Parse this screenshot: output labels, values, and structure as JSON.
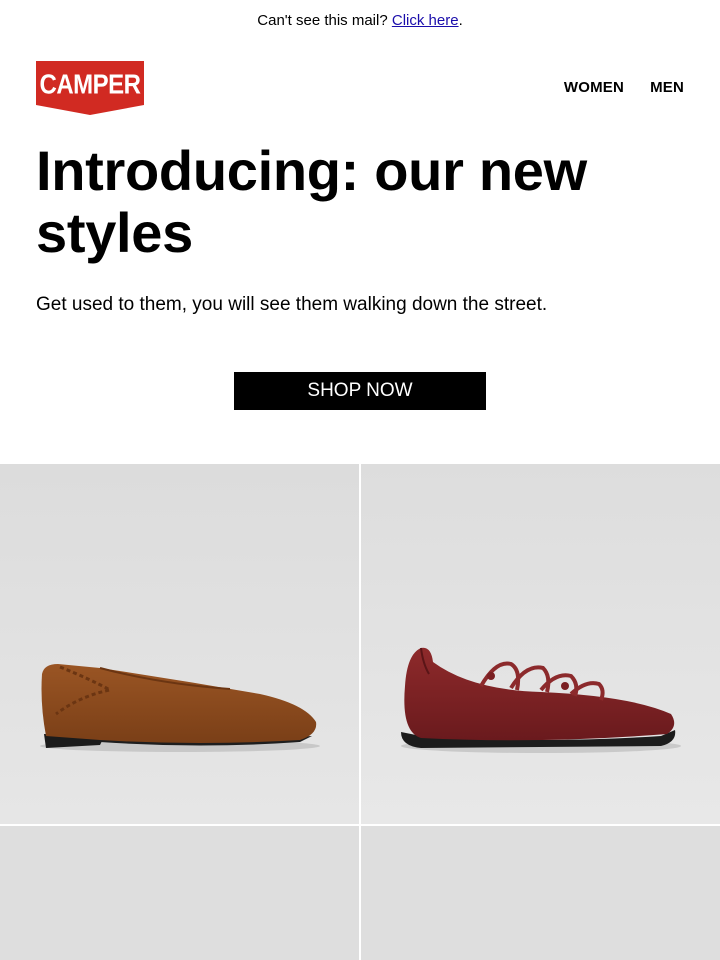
{
  "preheader": {
    "text": "Can't see this mail?",
    "link": "Click here",
    "suffix": "."
  },
  "brand": {
    "logo_text": "CAMPER",
    "color": "#D12A22"
  },
  "nav": {
    "women": "WOMEN",
    "men": "MEN"
  },
  "hero": {
    "title": "Introducing: our new styles",
    "subtitle": "Get used to them, you will see them walking down the street.",
    "cta": "SHOP NOW"
  },
  "products": [
    {
      "name": "brown-suede-flat-shoe-image",
      "color": "#8A4A1E"
    },
    {
      "name": "burgundy-leather-ballerina-shoe-image",
      "color": "#7A1F22"
    },
    {
      "name": "product-image-3"
    },
    {
      "name": "product-image-4"
    }
  ]
}
